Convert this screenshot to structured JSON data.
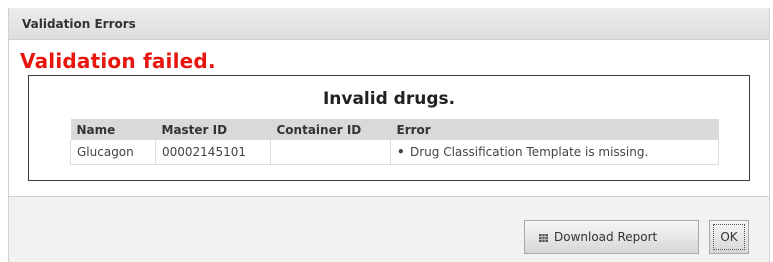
{
  "dialog": {
    "title": "Validation Errors",
    "status_message": "Validation failed.",
    "status_color": "#e8140e"
  },
  "invalid_drugs": {
    "caption": "Invalid drugs.",
    "columns": [
      "Name",
      "Master ID",
      "Container ID",
      "Error"
    ],
    "rows": [
      {
        "name": "Glucagon",
        "master_id": "00002145101",
        "container_id": "",
        "errors": [
          "Drug Classification Template is missing."
        ]
      }
    ]
  },
  "footer": {
    "download_label": "Download Report",
    "download_icon": "grid-icon",
    "ok_label": "OK"
  }
}
